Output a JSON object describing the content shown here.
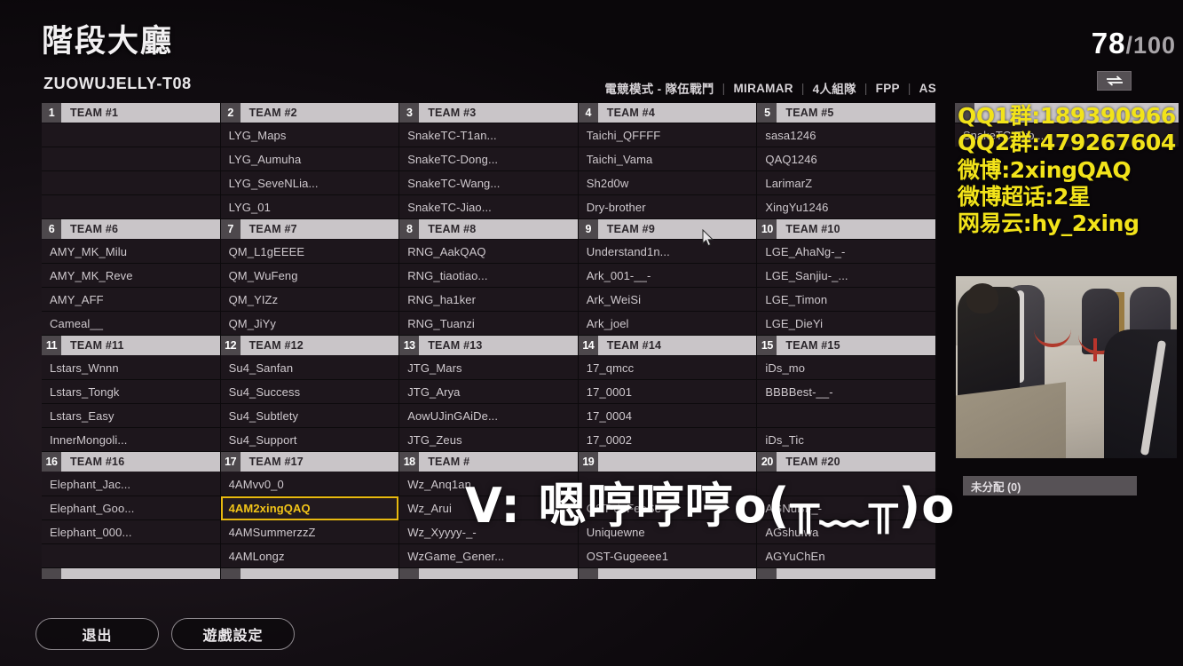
{
  "header": {
    "title": "階段大廳",
    "lobby_code": "ZUOWUJELLY-T08",
    "mode": "電競模式 - 隊伍戰鬥",
    "map": "MIRAMAR",
    "team_size": "4人組隊",
    "perspective": "FPP",
    "region": "AS",
    "separator": "|",
    "count_current": "78",
    "count_total": "/100",
    "swap_icon": "swap-arrows-icon"
  },
  "teams": [
    {
      "num": "1",
      "name": "TEAM #1",
      "players": [
        "",
        "",
        "",
        ""
      ]
    },
    {
      "num": "2",
      "name": "TEAM #2",
      "players": [
        "LYG_Maps",
        "LYG_Aumuha",
        "LYG_SeveNLia...",
        "LYG_01"
      ]
    },
    {
      "num": "3",
      "name": "TEAM #3",
      "players": [
        "SnakeTC-T1an...",
        "SnakeTC-Dong...",
        "SnakeTC-Wang...",
        "SnakeTC-Jiao..."
      ]
    },
    {
      "num": "4",
      "name": "TEAM #4",
      "players": [
        "Taichi_QFFFF",
        "Taichi_Vama",
        "Sh2d0w",
        "Dry-brother"
      ]
    },
    {
      "num": "5",
      "name": "TEAM #5",
      "players": [
        "sasa1246",
        "QAQ1246",
        "LarimarZ",
        "XingYu1246"
      ]
    },
    {
      "num": "6",
      "name": "TEAM #6",
      "players": [
        "AMY_MK_Milu",
        "AMY_MK_Reve",
        "AMY_AFF",
        "Cameal__"
      ]
    },
    {
      "num": "7",
      "name": "TEAM #7",
      "players": [
        "QM_L1gEEEE",
        "QM_WuFeng",
        "QM_YIZz",
        "QM_JiYy"
      ]
    },
    {
      "num": "8",
      "name": "TEAM #8",
      "players": [
        "RNG_AakQAQ",
        "RNG_tiaotiao...",
        "RNG_ha1ker",
        "RNG_Tuanzi"
      ]
    },
    {
      "num": "9",
      "name": "TEAM #9",
      "players": [
        "Understand1n...",
        "Ark_001-__-",
        "Ark_WeiSi",
        "Ark_joel"
      ]
    },
    {
      "num": "10",
      "name": "TEAM #10",
      "players": [
        "LGE_AhaNg-_-",
        "LGE_Sanjiu-_...",
        "LGE_Timon",
        "LGE_DieYi"
      ]
    },
    {
      "num": "11",
      "name": "TEAM #11",
      "players": [
        "Lstars_Wnnn",
        "Lstars_Tongk",
        "Lstars_Easy",
        "InnerMongoli..."
      ]
    },
    {
      "num": "12",
      "name": "TEAM #12",
      "players": [
        "Su4_Sanfan",
        "Su4_Success",
        "Su4_Subtlety",
        "Su4_Support"
      ]
    },
    {
      "num": "13",
      "name": "TEAM #13",
      "players": [
        "JTG_Mars",
        "JTG_Arya",
        "AowUJinGAiDe...",
        "JTG_Zeus"
      ]
    },
    {
      "num": "14",
      "name": "TEAM #14",
      "players": [
        "17_qmcc",
        "17_0001",
        "17_0004",
        "17_0002"
      ]
    },
    {
      "num": "15",
      "name": "TEAM #15",
      "players": [
        "iDs_mo",
        "BBBBest-__-",
        "",
        "iDs_Tic"
      ]
    },
    {
      "num": "16",
      "name": "TEAM #16",
      "players": [
        "Elephant_Jac...",
        "Elephant_Goo...",
        "Elephant_000...",
        ""
      ]
    },
    {
      "num": "17",
      "name": "TEAM #17",
      "players": [
        "4AMvv0_0",
        "4AM2xingQAQ",
        "4AMSummerzzZ",
        "4AMLongz"
      ],
      "highlight_index": 1
    },
    {
      "num": "18",
      "name": "TEAM #",
      "players": [
        "Wz_Anq1an",
        "Wz_Arui",
        "Wz_Xyyyy-_-",
        "WzGame_Gener..."
      ]
    },
    {
      "num": "19",
      "name": "",
      "players": [
        "",
        "OST-deFenSe",
        "Uniquewne",
        "OST-Gugeeee1"
      ]
    },
    {
      "num": "20",
      "name": "TEAM #20",
      "players": [
        "",
        "AGNuBi-_-",
        "AGshuiwa",
        "AGYuChEn"
      ]
    }
  ],
  "side_panel": {
    "team_label": "SnakeTC-Tup...",
    "unassigned_label": "未分配 (0)"
  },
  "stream_overlay": {
    "lines": [
      "QQ1群:189390966",
      "QQ2群:479267604",
      "微博:2xingQAQ",
      "微博超话:2星",
      "网易云:hy_2xing"
    ],
    "accent_color": "#f2e31a",
    "subtitle": "V: 嗯哼哼哼o(╥﹏╥)o"
  },
  "footer": {
    "exit_label": "退出",
    "settings_label": "遊戲設定"
  },
  "cursor": {
    "icon": "mouse-pointer-icon"
  }
}
